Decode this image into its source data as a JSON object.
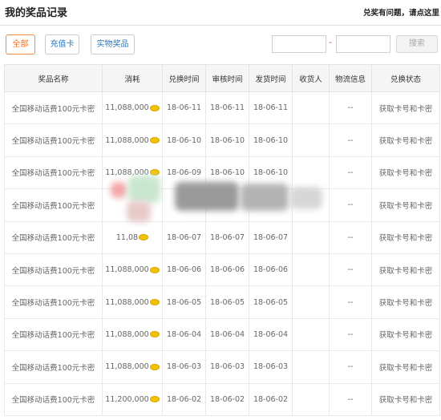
{
  "header": {
    "title": "我的奖品记录",
    "notice": "兑奖有问题，请点这里"
  },
  "filters": [
    {
      "label": "全部",
      "active": true
    },
    {
      "label": "充值卡",
      "active": false
    },
    {
      "label": "实物奖品",
      "active": false
    }
  ],
  "search": {
    "separator": "-",
    "button": "搜索"
  },
  "table": {
    "columns": [
      "奖品名称",
      "消耗",
      "兑换时间",
      "审核时间",
      "发货时间",
      "收货人",
      "物流信息",
      "兑换状态"
    ],
    "rows": [
      {
        "name": "全国移动话费100元卡密",
        "cost": "11,088,000",
        "exchange": "18-06-11",
        "review": "18-06-11",
        "ship": "18-06-11",
        "receiver": "",
        "logistics": "--",
        "status": "获取卡号和卡密"
      },
      {
        "name": "全国移动话费100元卡密",
        "cost": "11,088,000",
        "exchange": "18-06-10",
        "review": "18-06-10",
        "ship": "18-06-10",
        "receiver": "",
        "logistics": "--",
        "status": "获取卡号和卡密"
      },
      {
        "name": "全国移动话费100元卡密",
        "cost": "11,088,000",
        "exchange": "18-06-09",
        "review": "18-06-10",
        "ship": "18-06-10",
        "receiver": "",
        "logistics": "--",
        "status": "获取卡号和卡密"
      },
      {
        "name": "全国移动话费100元卡密",
        "cost": "",
        "exchange": "",
        "review": "",
        "ship": "",
        "receiver": "",
        "logistics": "--",
        "status": "获取卡号和卡密"
      },
      {
        "name": "全国移动话费100元卡密",
        "cost": "11,08",
        "exchange": "18-06-07",
        "review": "18-06-07",
        "ship": "18-06-07",
        "receiver": "",
        "logistics": "--",
        "status": "获取卡号和卡密"
      },
      {
        "name": "全国移动话费100元卡密",
        "cost": "11,088,000",
        "exchange": "18-06-06",
        "review": "18-06-06",
        "ship": "18-06-06",
        "receiver": "",
        "logistics": "--",
        "status": "获取卡号和卡密"
      },
      {
        "name": "全国移动话费100元卡密",
        "cost": "11,088,000",
        "exchange": "18-06-05",
        "review": "18-06-05",
        "ship": "18-06-05",
        "receiver": "",
        "logistics": "--",
        "status": "获取卡号和卡密"
      },
      {
        "name": "全国移动话费100元卡密",
        "cost": "11,088,000",
        "exchange": "18-06-04",
        "review": "18-06-04",
        "ship": "18-06-04",
        "receiver": "",
        "logistics": "--",
        "status": "获取卡号和卡密"
      },
      {
        "name": "全国移动话费100元卡密",
        "cost": "11,088,000",
        "exchange": "18-06-03",
        "review": "18-06-03",
        "ship": "18-06-03",
        "receiver": "",
        "logistics": "--",
        "status": "获取卡号和卡密"
      },
      {
        "name": "全国移动话费100元卡密",
        "cost": "11,200,000",
        "exchange": "18-06-02",
        "review": "18-06-02",
        "ship": "18-06-02",
        "receiver": "",
        "logistics": "--",
        "status": "获取卡号和卡密"
      }
    ]
  },
  "colors": {
    "accent_orange": "#f07020",
    "link_blue": "#2a72c0",
    "cost_red": "#e02020",
    "coin_gold": "#f2c200"
  },
  "icons": {
    "coin": "gold-coin-icon"
  }
}
